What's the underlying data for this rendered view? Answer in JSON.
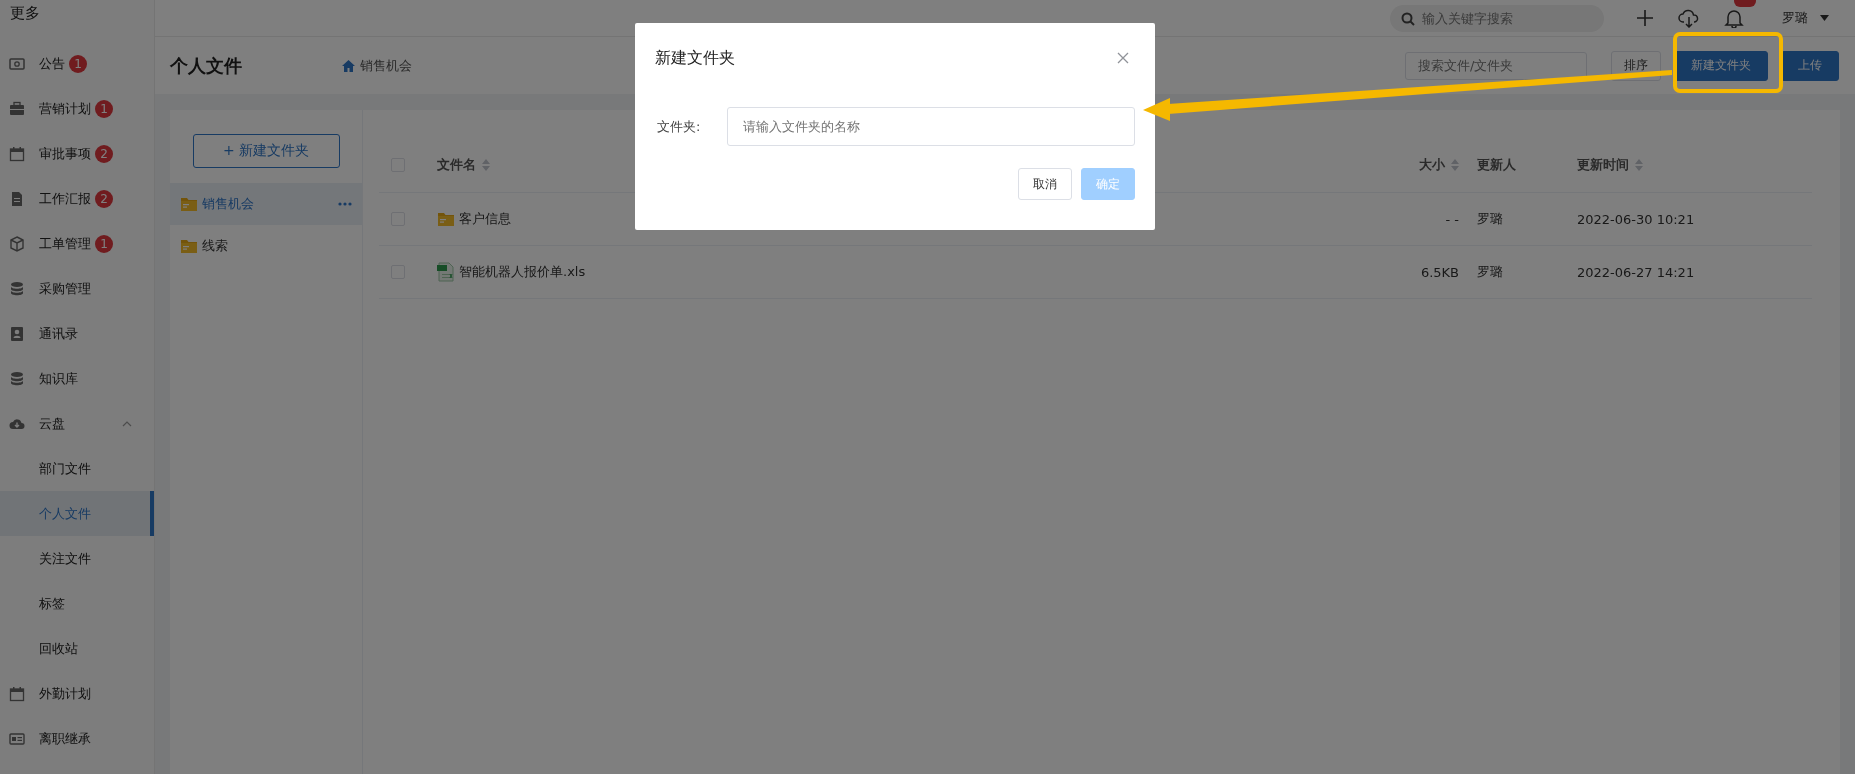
{
  "sidebar": {
    "title": "更多",
    "items": [
      {
        "label": "公告",
        "badge": "1",
        "selected": false
      },
      {
        "label": "营销计划",
        "badge": "1",
        "selected": false
      },
      {
        "label": "审批事项",
        "badge": "2",
        "selected": false
      },
      {
        "label": "工作汇报",
        "badge": "2",
        "selected": false
      },
      {
        "label": "工单管理",
        "badge": "1",
        "selected": false
      },
      {
        "label": "采购管理",
        "selected": false
      },
      {
        "label": "通讯录",
        "selected": false
      },
      {
        "label": "知识库",
        "selected": false
      },
      {
        "label": "云盘",
        "expanded": true,
        "selected": false,
        "children": [
          {
            "label": "部门文件",
            "selected": false
          },
          {
            "label": "个人文件",
            "selected": true
          },
          {
            "label": "关注文件",
            "selected": false
          },
          {
            "label": "标签",
            "selected": false
          },
          {
            "label": "回收站",
            "selected": false
          }
        ]
      },
      {
        "label": "外勤计划",
        "selected": false
      },
      {
        "label": "离职继承",
        "selected": false
      }
    ]
  },
  "topbar": {
    "search": {
      "placeholder": "输入关键字搜索"
    },
    "user": "罗璐"
  },
  "header": {
    "title": "个人文件",
    "breadcrumb": "销售机会",
    "search": {
      "placeholder": "搜索文件/文件夹"
    },
    "buttons": [
      {
        "label": "排序",
        "kind": "plain"
      },
      {
        "label": "新建文件夹",
        "kind": "primary"
      },
      {
        "label": "上传",
        "kind": "primary"
      }
    ]
  },
  "folders": {
    "new_button": "+ 新建文件夹",
    "items": [
      {
        "label": "销售机会",
        "selected": true
      },
      {
        "label": "线索",
        "selected": false
      }
    ]
  },
  "table": {
    "select_all_checked": false,
    "columns": [
      {
        "label": "文件名",
        "sortable": true
      },
      {
        "label": "大小",
        "sortable": true
      },
      {
        "label": "更新人",
        "sortable": false
      },
      {
        "label": "更新时间",
        "sortable": true
      }
    ],
    "rows": [
      {
        "kind": "folder",
        "name": "客户信息",
        "size": "- -",
        "updater": "罗璐",
        "time": "2022-06-30 10:21",
        "checked": false
      },
      {
        "kind": "excel",
        "name": "智能机器人报价单.xls",
        "size": "6.5KB",
        "updater": "罗璐",
        "time": "2022-06-27 14:21",
        "checked": false
      }
    ]
  },
  "dialog": {
    "title": "新建文件夹",
    "field_label": "文件夹:",
    "placeholder": "请输入文件夹的名称",
    "buttons": [
      {
        "label": "取消",
        "kind": "plain",
        "disabled": false
      },
      {
        "label": "确定",
        "kind": "primary",
        "disabled": true
      }
    ]
  }
}
